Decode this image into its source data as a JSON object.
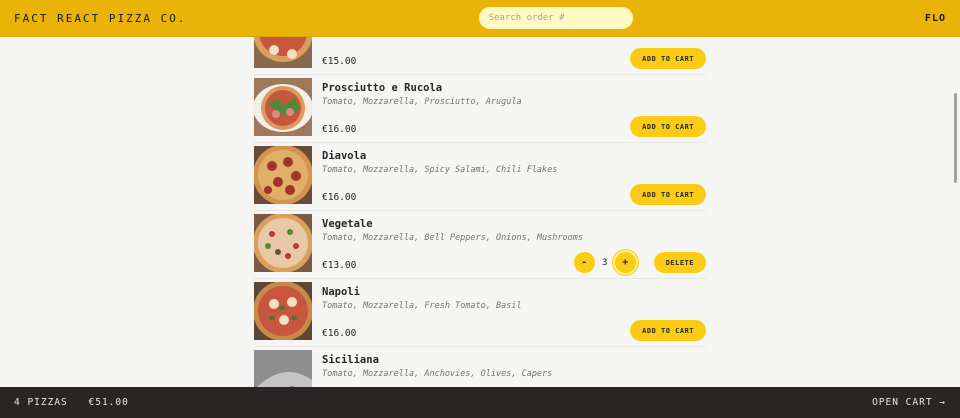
{
  "header": {
    "brand": "FACT REACT PIZZA CO.",
    "search_placeholder": "Search order #",
    "user": "FLO"
  },
  "menu": [
    {
      "name": "",
      "ingredients": "",
      "price": "€15.00",
      "action": "ADD TO CART",
      "image": "pizza",
      "grayscale": false
    },
    {
      "name": "Prosciutto e Rucola",
      "ingredients": "Tomato, Mozzarella, Prosciutto, Arugula",
      "price": "€16.00",
      "action": "ADD TO CART",
      "image": "pizza-arugula",
      "grayscale": false
    },
    {
      "name": "Diavola",
      "ingredients": "Tomato, Mozzarella, Spicy Salami, Chili Flakes",
      "price": "€16.00",
      "action": "ADD TO CART",
      "image": "pizza-salami",
      "grayscale": false
    },
    {
      "name": "Vegetale",
      "ingredients": "Tomato, Mozzarella, Bell Peppers, Onions, Mushrooms",
      "price": "€13.00",
      "quantity": "3",
      "decrement": "-",
      "increment": "+",
      "delete": "DELETE",
      "image": "pizza-veg",
      "grayscale": false
    },
    {
      "name": "Napoli",
      "ingredients": "Tomato, Mozzarella, Fresh Tomato, Basil",
      "price": "€16.00",
      "action": "ADD TO CART",
      "image": "pizza-basil",
      "grayscale": false
    },
    {
      "name": "Siciliana",
      "ingredients": "Tomato, Mozzarella, Anchovies, Olives, Capers",
      "price": "",
      "action": "",
      "image": "pizza-soldout",
      "grayscale": true
    }
  ],
  "cart": {
    "count": "4 PIZZAS",
    "total": "€51.00",
    "open": "OPEN CART →"
  },
  "colors": {
    "accent": "#eab308",
    "button": "#facc15",
    "footer": "#292524"
  }
}
